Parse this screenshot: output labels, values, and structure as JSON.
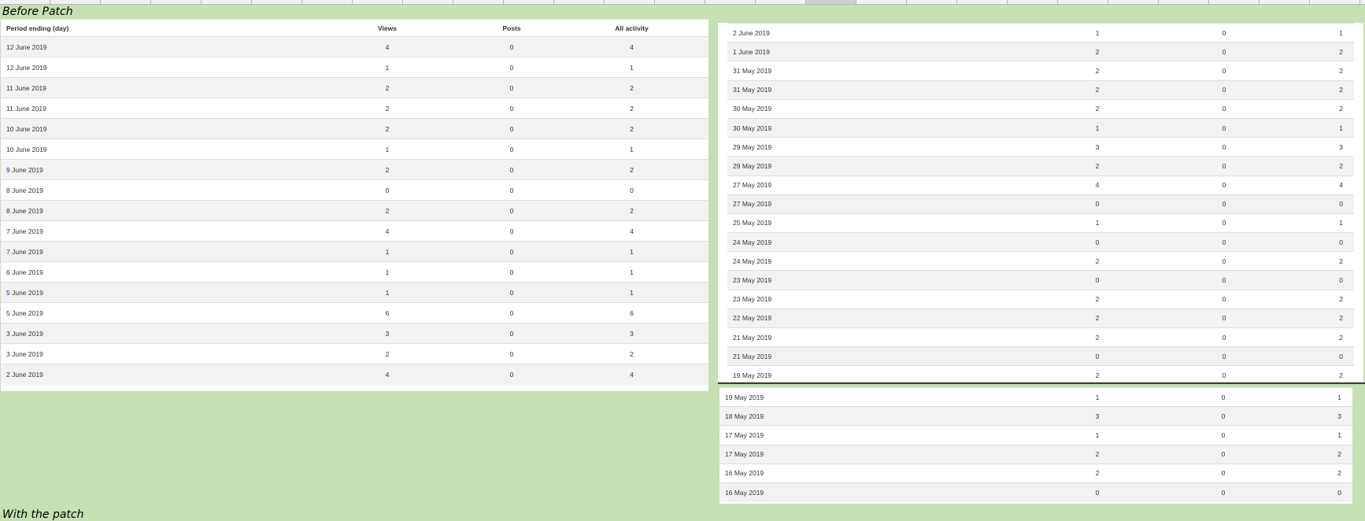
{
  "labels": {
    "before": "Before Patch",
    "with": "With the patch"
  },
  "headers": {
    "period": "Period ending (day)",
    "views": "Views",
    "posts": "Posts",
    "all": "All activity"
  },
  "left_rows": [
    {
      "date": "12 June 2019",
      "views": "4",
      "posts": "0",
      "all": "4"
    },
    {
      "date": "12 June 2019",
      "views": "1",
      "posts": "0",
      "all": "1"
    },
    {
      "date": "11 June 2019",
      "views": "2",
      "posts": "0",
      "all": "2"
    },
    {
      "date": "11 June 2019",
      "views": "2",
      "posts": "0",
      "all": "2"
    },
    {
      "date": "10 June 2019",
      "views": "2",
      "posts": "0",
      "all": "2"
    },
    {
      "date": "10 June 2019",
      "views": "1",
      "posts": "0",
      "all": "1"
    },
    {
      "date": "9 June 2019",
      "views": "2",
      "posts": "0",
      "all": "2"
    },
    {
      "date": "8 June 2019",
      "views": "0",
      "posts": "0",
      "all": "0"
    },
    {
      "date": "8 June 2019",
      "views": "2",
      "posts": "0",
      "all": "2"
    },
    {
      "date": "7 June 2019",
      "views": "4",
      "posts": "0",
      "all": "4"
    },
    {
      "date": "7 June 2019",
      "views": "1",
      "posts": "0",
      "all": "1"
    },
    {
      "date": "6 June 2019",
      "views": "1",
      "posts": "0",
      "all": "1"
    },
    {
      "date": "5 June 2019",
      "views": "1",
      "posts": "0",
      "all": "1"
    },
    {
      "date": "5 June 2019",
      "views": "6",
      "posts": "0",
      "all": "6"
    },
    {
      "date": "3 June 2019",
      "views": "3",
      "posts": "0",
      "all": "3"
    },
    {
      "date": "3 June 2019",
      "views": "2",
      "posts": "0",
      "all": "2"
    },
    {
      "date": "2 June 2019",
      "views": "4",
      "posts": "0",
      "all": "4"
    }
  ],
  "right_top_rows": [
    {
      "date": "2 June 2019",
      "views": "1",
      "posts": "0",
      "all": "1"
    },
    {
      "date": "1 June 2019",
      "views": "2",
      "posts": "0",
      "all": "2"
    },
    {
      "date": "31 May 2019",
      "views": "2",
      "posts": "0",
      "all": "2"
    },
    {
      "date": "31 May 2019",
      "views": "2",
      "posts": "0",
      "all": "2"
    },
    {
      "date": "30 May 2019",
      "views": "2",
      "posts": "0",
      "all": "2"
    },
    {
      "date": "30 May 2019",
      "views": "1",
      "posts": "0",
      "all": "1"
    },
    {
      "date": "29 May 2019",
      "views": "3",
      "posts": "0",
      "all": "3"
    },
    {
      "date": "29 May 2019",
      "views": "2",
      "posts": "0",
      "all": "2"
    },
    {
      "date": "27 May 2019",
      "views": "4",
      "posts": "0",
      "all": "4"
    },
    {
      "date": "27 May 2019",
      "views": "0",
      "posts": "0",
      "all": "0"
    },
    {
      "date": "25 May 2019",
      "views": "1",
      "posts": "0",
      "all": "1"
    },
    {
      "date": "24 May 2019",
      "views": "0",
      "posts": "0",
      "all": "0"
    },
    {
      "date": "24 May 2019",
      "views": "2",
      "posts": "0",
      "all": "2"
    },
    {
      "date": "23 May 2019",
      "views": "0",
      "posts": "0",
      "all": "0"
    },
    {
      "date": "23 May 2019",
      "views": "2",
      "posts": "0",
      "all": "2"
    },
    {
      "date": "22 May 2019",
      "views": "2",
      "posts": "0",
      "all": "2"
    },
    {
      "date": "21 May 2019",
      "views": "2",
      "posts": "0",
      "all": "2"
    },
    {
      "date": "21 May 2019",
      "views": "0",
      "posts": "0",
      "all": "0"
    },
    {
      "date": "19 May 2019",
      "views": "2",
      "posts": "0",
      "all": "2"
    }
  ],
  "right_bottom_rows": [
    {
      "date": "19 May 2019",
      "views": "1",
      "posts": "0",
      "all": "1"
    },
    {
      "date": "18 May 2019",
      "views": "3",
      "posts": "0",
      "all": "3"
    },
    {
      "date": "17 May 2019",
      "views": "1",
      "posts": "0",
      "all": "1"
    },
    {
      "date": "17 May 2019",
      "views": "2",
      "posts": "0",
      "all": "2"
    },
    {
      "date": "16 May 2019",
      "views": "2",
      "posts": "0",
      "all": "2"
    },
    {
      "date": "16 May 2019",
      "views": "0",
      "posts": "0",
      "all": "0"
    }
  ]
}
